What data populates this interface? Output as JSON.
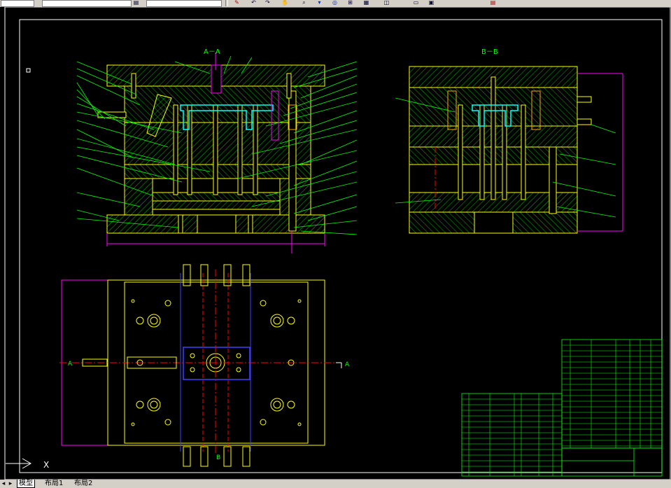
{
  "toolbar": {
    "icons": [
      "layer-dropdown",
      "layer-properties-icon",
      "match-properties-icon",
      "undo-icon",
      "redo-icon",
      "pan-icon",
      "zoom-realtime-icon",
      "zoom-window-icon",
      "zoom-previous-icon",
      "properties-icon",
      "design-center-icon",
      "tool-palettes-icon",
      "sheet-set-icon",
      "markup-icon",
      "calculator-icon"
    ]
  },
  "drawing": {
    "section_aa_title": "A－A",
    "section_bb_title": "B－B",
    "plan_cut_label_left": "A",
    "plan_cut_label_right": "A",
    "plan_cut_label_bottom": "B",
    "ucs_axis_label": "X"
  },
  "colors": {
    "background": "#000000",
    "frame": "#ffffff",
    "outline": "#ffff00",
    "hatch": "#00ff00",
    "leader": "#00ff00",
    "centerline": "#ff0000",
    "dimension": "#ff00ff",
    "cooling": "#00ffff",
    "parting": "#4040ff"
  },
  "tabs": {
    "model": "模型",
    "layout1": "布局1",
    "layout2": "布局2"
  }
}
